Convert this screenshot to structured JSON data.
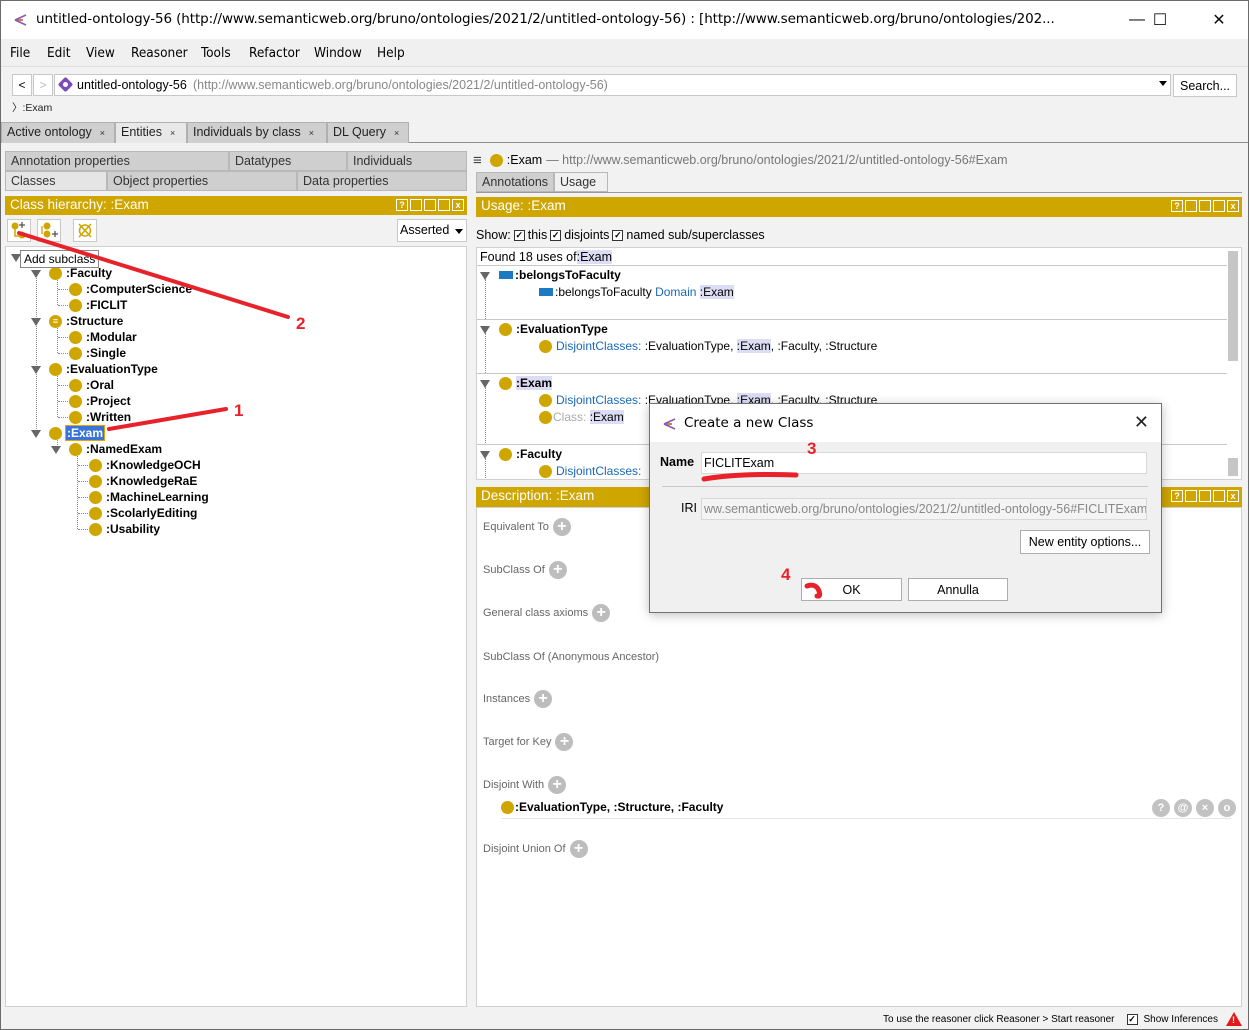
{
  "window": {
    "title": "untitled-ontology-56 (http://www.semanticweb.org/bruno/ontologies/2021/2/untitled-ontology-56)  : [http://www.semanticweb.org/bruno/ontologies/202...",
    "minimize": "—",
    "maximize": "☐",
    "close": "✕"
  },
  "menu": [
    "File",
    "Edit",
    "View",
    "Reasoner",
    "Tools",
    "Refactor",
    "Window",
    "Help"
  ],
  "address": {
    "back": "<",
    "forward": ">",
    "ontology_name": "untitled-ontology-56",
    "ontology_iri": "(http://www.semanticweb.org/bruno/ontologies/2021/2/untitled-ontology-56)",
    "search_label": "Search...",
    "breadcrumb": "〉:Exam"
  },
  "workspace_tabs": [
    {
      "label": "Active ontology",
      "close": "×",
      "active": false
    },
    {
      "label": "Entities",
      "close": "×",
      "active": true
    },
    {
      "label": "Individuals by class",
      "close": "×",
      "active": false
    },
    {
      "label": "DL Query",
      "close": "×",
      "active": false
    }
  ],
  "left_panel": {
    "tabs_row1": [
      "Annotation properties",
      "Datatypes",
      "Individuals"
    ],
    "tabs_row2": [
      "Classes",
      "Object properties",
      "Data properties"
    ],
    "active_tab": "Classes",
    "header": "Class hierarchy: :Exam",
    "view_controls": [
      "?",
      "▯▯",
      "▭",
      "■",
      "✕"
    ],
    "mode_select": "Asserted",
    "tooltip": "Add subclass",
    "tree": [
      {
        "label": ":Faculty",
        "level": 1,
        "expanded": true
      },
      {
        "label": ":ComputerScience",
        "level": 2
      },
      {
        "label": ":FICLIT",
        "level": 2
      },
      {
        "label": ":Structure",
        "level": 1,
        "expanded": true,
        "equivalent": true
      },
      {
        "label": ":Modular",
        "level": 2
      },
      {
        "label": ":Single",
        "level": 2
      },
      {
        "label": ":EvaluationType",
        "level": 1,
        "expanded": true
      },
      {
        "label": ":Oral",
        "level": 2
      },
      {
        "label": ":Project",
        "level": 2
      },
      {
        "label": ":Written",
        "level": 2
      },
      {
        "label": ":Exam",
        "level": 1,
        "expanded": true,
        "selected": true
      },
      {
        "label": ":NamedExam",
        "level": 2,
        "expanded": true
      },
      {
        "label": ":KnowledgeOCH",
        "level": 3
      },
      {
        "label": ":KnowledgeRaE",
        "level": 3
      },
      {
        "label": ":MachineLearning",
        "level": 3
      },
      {
        "label": ":ScolarlyEditing",
        "level": 3
      },
      {
        "label": ":Usability",
        "level": 3
      }
    ]
  },
  "right_panel": {
    "entity_name": ":Exam",
    "entity_iri": "— http://www.semanticweb.org/bruno/ontologies/2021/2/untitled-ontology-56#Exam",
    "tabs": [
      "Annotations",
      "Usage"
    ],
    "active_tab": "Usage",
    "usage_header": "Usage: :Exam",
    "show_label": "Show:",
    "show_options": [
      {
        "label": "this",
        "checked": true
      },
      {
        "label": "disjoints",
        "checked": true
      },
      {
        "label": "named sub/superclasses",
        "checked": true
      }
    ],
    "found_text": "Found 18 uses of",
    "found_entity": ":Exam",
    "usage_sections": [
      {
        "title": ":belongsToFaculty",
        "type": "object-property",
        "rows": [
          {
            "subject": ":belongsToFaculty",
            "keyword": "Domain",
            "object": ":Exam"
          }
        ]
      },
      {
        "title": ":EvaluationType",
        "type": "class",
        "rows": [
          {
            "keyword": "DisjointClasses:",
            "rest_a": ":EvaluationType,",
            "hl": ":Exam",
            "rest_b": ", :Faculty, :Structure"
          }
        ]
      },
      {
        "title": ":Exam",
        "type": "class",
        "rows": [
          {
            "keyword": "DisjointClasses:",
            "rest_a": ":EvaluationType,",
            "hl": ":Exam",
            "rest_b": ", :Faculty, :Structure"
          },
          {
            "keyword": "Class:",
            "hl": ":Exam"
          }
        ]
      },
      {
        "title": ":Faculty",
        "type": "class",
        "rows": [
          {
            "keyword": "DisjointClasses:"
          }
        ]
      }
    ],
    "description_header": "Description: :Exam",
    "description_sections": [
      {
        "label": "Equivalent To",
        "has_add": true
      },
      {
        "label": "SubClass Of",
        "has_add": true
      },
      {
        "label": "General class axioms",
        "has_add": true
      },
      {
        "label": "SubClass Of (Anonymous Ancestor)",
        "has_add": false
      },
      {
        "label": "Instances",
        "has_add": true
      },
      {
        "label": "Target for Key",
        "has_add": true
      },
      {
        "label": "Disjoint With",
        "has_add": true
      },
      {
        "label": "Disjoint Union Of",
        "has_add": true
      }
    ],
    "disjoint_with_value": ":EvaluationType, :Structure, :Faculty",
    "row_buttons": [
      "?",
      "@",
      "×",
      "o"
    ]
  },
  "dialog": {
    "title": "Create a new Class",
    "close": "✕",
    "name_label": "Name",
    "name_value": "FICLITExam",
    "iri_label": "IRI",
    "iri_value": "ww.semanticweb.org/bruno/ontologies/2021/2/untitled-ontology-56#FICLITExam",
    "options_button": "New entity options...",
    "ok_button": "OK",
    "cancel_button": "Annulla"
  },
  "status_bar": {
    "message": "To use the reasoner click Reasoner > Start reasoner",
    "show_inferences_label": "Show Inferences",
    "show_inferences_checked": true
  },
  "annotations": {
    "step1": "1",
    "step2": "2",
    "step3": "3",
    "step4": "4"
  },
  "colors": {
    "view_header": "#cfa500",
    "class_icon": "#cfa500",
    "object_property_icon": "#1c7ac2",
    "selection": "#3875d7",
    "keyword": "#1a68b8",
    "annotation_red": "#e8222a"
  }
}
